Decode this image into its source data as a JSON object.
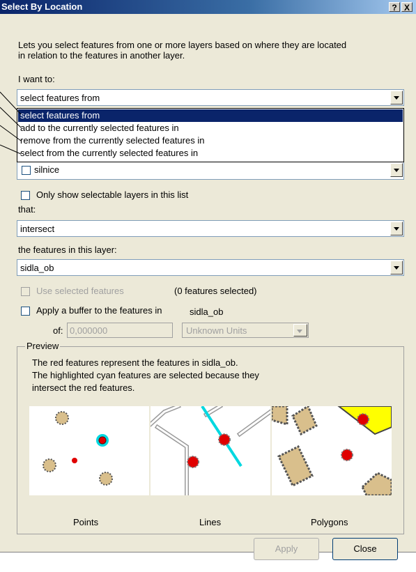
{
  "window": {
    "title": "Select By Location",
    "help_label": "?",
    "close_label": "X"
  },
  "description": {
    "line1": "Lets you select features from one or more layers based on where they are located",
    "line2": "in relation to the features in another layer."
  },
  "i_want_to": {
    "label": "I want to:",
    "value": "select features from",
    "options": [
      "select features from",
      "add to the currently selected features in",
      "remove from the currently selected features in",
      "select from the currently selected features in"
    ],
    "selected_index": 0
  },
  "layers_list": {
    "visible_item": "silnice"
  },
  "only_selectable": {
    "label": "Only show selectable layers in this list",
    "checked": false
  },
  "that": {
    "label": "that:",
    "value": "intersect"
  },
  "source_layer": {
    "label": "the features in this layer:",
    "value": "sidla_ob"
  },
  "use_selected": {
    "label": "Use selected features",
    "count_text": "(0 features selected)",
    "enabled": false
  },
  "buffer": {
    "label": "Apply a buffer to the features in",
    "layer": "sidla_ob",
    "of_label": "of:",
    "distance": "0,000000",
    "units": "Unknown Units",
    "checked": false
  },
  "preview": {
    "legend": "Preview",
    "line1": "The red features represent the features in  sidla_ob.",
    "line2": "The highlighted cyan features are selected because they",
    "line3": "intersect the red features.",
    "captions": [
      "Points",
      "Lines",
      "Polygons"
    ]
  },
  "buttons": {
    "apply": "Apply",
    "close": "Close"
  },
  "colors": {
    "titlebar": "#0a246a",
    "selection": "#0a246a",
    "red_feature": "#e00000",
    "cyan_feature": "#00d8e0",
    "tan_feature": "#d9bf8c",
    "yellow_polygon": "#ffff00"
  }
}
